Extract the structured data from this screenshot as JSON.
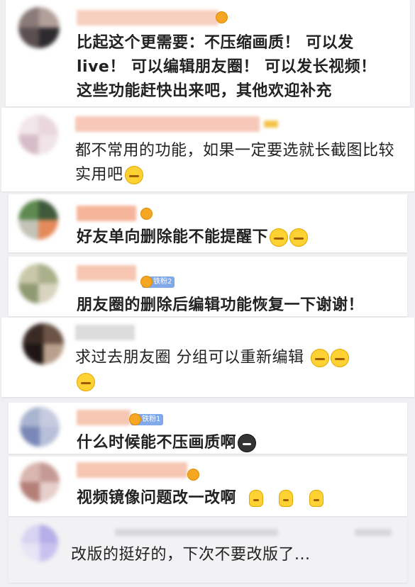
{
  "comments": [
    {
      "text": "比起这个更需要：不压缩画质！ 可以发live！ 可以编辑朋友圈！ 可以发长视频！这些功能赶快出来吧，其他欢迎补充"
    },
    {
      "text": "都不常用的功能，如果一定要选就长截图比较实用吧"
    },
    {
      "text": "好友单向删除能不能提醒下"
    },
    {
      "text": "朋友圈的删除后编辑功能恢复一下谢谢！",
      "badge": "铁粉2"
    },
    {
      "text": "求过去朋友圈 分组可以重新编辑"
    },
    {
      "text": "什么时候能不压画质啊",
      "badge": "铁粉1"
    },
    {
      "text": "视频镜像问题改一改啊"
    },
    {
      "text": "改版的挺好的，下次不要改版了..."
    }
  ],
  "emoji": {
    "laugh_cry": "laugh-cry-emoji",
    "awkward": "awkward-smile-emoji",
    "crying": "crying-emoji",
    "dark_tear": "dark-tear-emoji",
    "figure": "small-figure-emoji"
  },
  "colors": {
    "name_pink": "#f6c9b6",
    "badge_blue": "#7fa9e8",
    "card_bg": "#ffffff",
    "page_bg": "#f0f0f2"
  }
}
